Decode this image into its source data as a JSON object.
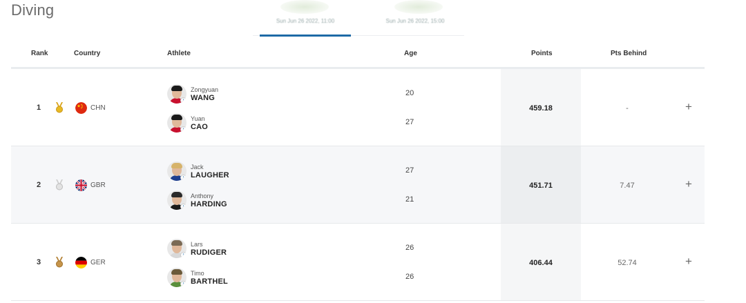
{
  "page": {
    "title": "Diving"
  },
  "tabs": [
    {
      "label": "Sun Jun 26 2022, 11:00",
      "active": true
    },
    {
      "label": "Sun Jun 26 2022, 15:00",
      "active": false
    }
  ],
  "table": {
    "headers": {
      "rank": "Rank",
      "country": "Country",
      "athlete": "Athlete",
      "age": "Age",
      "points": "Points",
      "behind": "Pts Behind"
    },
    "rows": [
      {
        "rank": "1",
        "medal": "gold-medal-icon",
        "country": "CHN",
        "flag": "china-flag-icon",
        "athletes": [
          {
            "first": "Zongyuan",
            "last": "WANG",
            "age": "20"
          },
          {
            "first": "Yuan",
            "last": "CAO",
            "age": "27"
          }
        ],
        "points": "459.18",
        "behind": "-",
        "expand": "+"
      },
      {
        "rank": "2",
        "medal": "silver-medal-icon",
        "country": "GBR",
        "flag": "uk-flag-icon",
        "athletes": [
          {
            "first": "Jack",
            "last": "LAUGHER",
            "age": "27"
          },
          {
            "first": "Anthony",
            "last": "HARDING",
            "age": "21"
          }
        ],
        "points": "451.71",
        "behind": "7.47",
        "expand": "+"
      },
      {
        "rank": "3",
        "medal": "bronze-medal-icon",
        "country": "GER",
        "flag": "germany-flag-icon",
        "athletes": [
          {
            "first": "Lars",
            "last": "RUDIGER",
            "age": "26"
          },
          {
            "first": "Timo",
            "last": "BARTHEL",
            "age": "26"
          }
        ],
        "points": "406.44",
        "behind": "52.74",
        "expand": "+"
      }
    ]
  },
  "colors": {
    "accent": "#1d6aa6",
    "gold": "#d9a51c",
    "silver": "#c8c8c8",
    "bronze": "#b5843a"
  }
}
